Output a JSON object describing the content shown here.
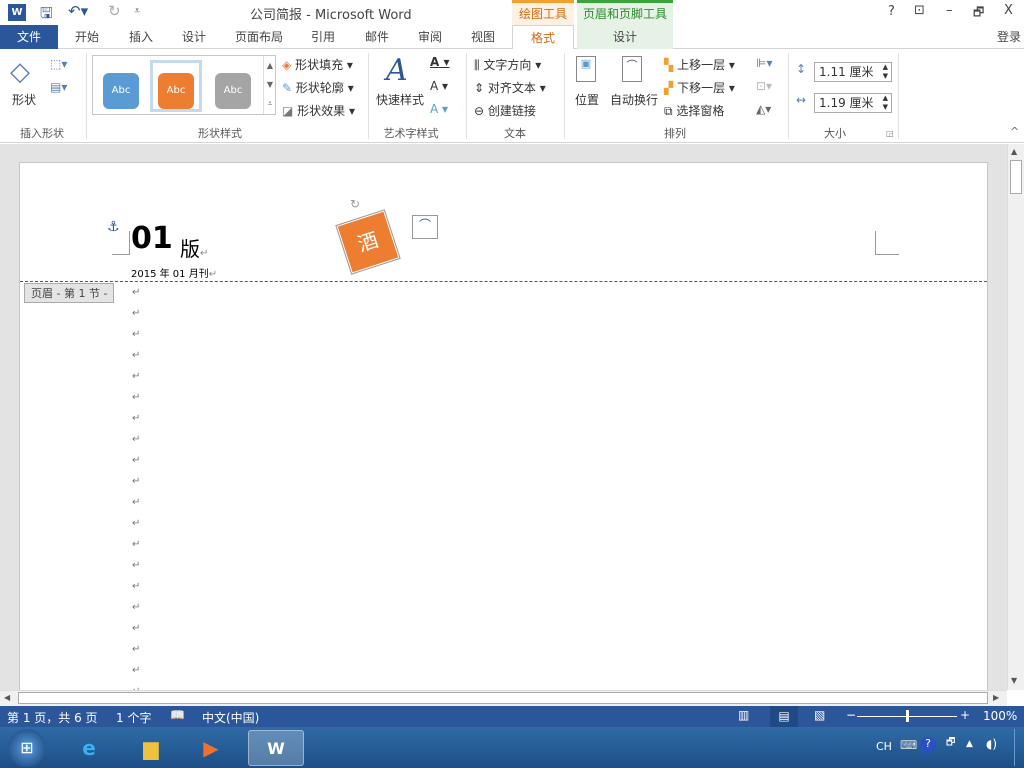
{
  "titlebar": {
    "title": "公司简报 - Microsoft Word",
    "context_drawing": "绘图工具",
    "context_header": "页眉和页脚工具",
    "help": "?",
    "ribbon_display": "⊡",
    "minimize": "–",
    "restore": "🗗",
    "close": "X"
  },
  "tabs": {
    "file": "文件",
    "items": [
      "开始",
      "插入",
      "设计",
      "页面布局",
      "引用",
      "邮件",
      "审阅",
      "视图"
    ],
    "format": "格式",
    "design": "设计",
    "login": "登录"
  },
  "ribbon": {
    "insert_shapes": {
      "label": "插入形状",
      "shapes": "形状"
    },
    "shape_styles": {
      "label": "形状样式",
      "swatches": [
        {
          "text": "Abc",
          "color": "#5b9bd5"
        },
        {
          "text": "Abc",
          "color": "#ed7d31"
        },
        {
          "text": "Abc",
          "color": "#a5a5a5"
        }
      ],
      "fill": "形状填充",
      "outline": "形状轮廓",
      "effects": "形状效果"
    },
    "wordart": {
      "label": "艺术字样式",
      "quick": "快速样式"
    },
    "text": {
      "label": "文本",
      "direction": "文字方向",
      "align": "对齐文本",
      "link": "创建链接"
    },
    "arrange": {
      "label": "排列",
      "position": "位置",
      "wrap": "自动换行",
      "forward": "上移一层",
      "backward": "下移一层",
      "pane": "选择窗格"
    },
    "size": {
      "label": "大小",
      "height": "1.11 厘米",
      "width": "1.19 厘米"
    }
  },
  "document": {
    "heading_num": "01",
    "heading_text": "版",
    "date": "2015 年 01 月刊",
    "shape_text": "酒",
    "header_tag": "页眉 - 第 1 节 -",
    "para_mark": "↵"
  },
  "status": {
    "page": "第 1 页，共 6 页",
    "words": "1 个字",
    "lang": "中文(中国)",
    "zoom": "100%",
    "zoom_level": 100
  },
  "taskbar": {
    "ime": "CH"
  }
}
